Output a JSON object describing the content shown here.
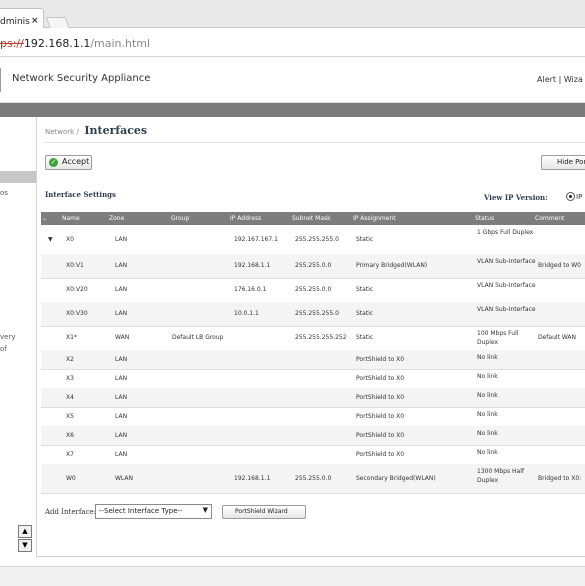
{
  "browser": {
    "tab_title": "dminis",
    "tab_close": "×",
    "url_scheme": "ps://",
    "url_host": "192.168.1.1",
    "url_path": "/main.html"
  },
  "header": {
    "product": "Network Security Appliance",
    "links": "Alert | Wiza"
  },
  "sidebar": {
    "fragments": [
      "os",
      "very",
      "of"
    ]
  },
  "page": {
    "breadcrumb": "Network /",
    "title": "Interfaces",
    "accept_label": "Accept",
    "hide_label": "Hide Por",
    "section_title": "Interface Settings",
    "view_ip_label": "View IP Version:",
    "ip_option": "IP"
  },
  "table": {
    "columns": [
      "Name",
      "Zone",
      "Group",
      "IP Address",
      "Subnet Mask",
      "IP Assignment",
      "Status",
      "Comment"
    ],
    "rows": [
      {
        "expander": "▼",
        "name": "X0",
        "zone": "LAN",
        "group": "",
        "ip": "192.167.167.1",
        "mask": "255.255.255.0",
        "assign": "Static",
        "status": "1 Gbps Full Duplex",
        "comment": ""
      },
      {
        "expander": "",
        "name": "X0:V1",
        "zone": "LAN",
        "group": "",
        "ip": "192.168.1.1",
        "mask": "255.255.0.0",
        "assign": "Primary Bridged(WLAN)",
        "status": "VLAN Sub-Interface",
        "comment": "Bridged to W0"
      },
      {
        "expander": "",
        "name": "X0:V20",
        "zone": "LAN",
        "group": "",
        "ip": "176.16.0.1",
        "mask": "255.255.0.0",
        "assign": "Static",
        "status": "VLAN Sub-Interface",
        "comment": ""
      },
      {
        "expander": "",
        "name": "X0:V30",
        "zone": "LAN",
        "group": "",
        "ip": "10.0.1.1",
        "mask": "255.255.255.0",
        "assign": "Static",
        "status": "VLAN Sub-Interface",
        "comment": ""
      },
      {
        "expander": "",
        "name": "X1*",
        "zone": "WAN",
        "group": "Default LB Group",
        "ip": "",
        "mask": "255.255.255.252",
        "assign": "Static",
        "status": "100 Mbps Full Duplex",
        "comment": "Default WAN"
      },
      {
        "expander": "",
        "name": "X2",
        "zone": "LAN",
        "group": "",
        "ip": "",
        "mask": "",
        "assign": "PortShield to X0",
        "status": "No link",
        "comment": ""
      },
      {
        "expander": "",
        "name": "X3",
        "zone": "LAN",
        "group": "",
        "ip": "",
        "mask": "",
        "assign": "PortShield to X0",
        "status": "No link",
        "comment": ""
      },
      {
        "expander": "",
        "name": "X4",
        "zone": "LAN",
        "group": "",
        "ip": "",
        "mask": "",
        "assign": "PortShield to X0",
        "status": "No link",
        "comment": ""
      },
      {
        "expander": "",
        "name": "X5",
        "zone": "LAN",
        "group": "",
        "ip": "",
        "mask": "",
        "assign": "PortShield to X0",
        "status": "No link",
        "comment": ""
      },
      {
        "expander": "",
        "name": "X6",
        "zone": "LAN",
        "group": "",
        "ip": "",
        "mask": "",
        "assign": "PortShield to X0",
        "status": "No link",
        "comment": ""
      },
      {
        "expander": "",
        "name": "X7",
        "zone": "LAN",
        "group": "",
        "ip": "",
        "mask": "",
        "assign": "PortShield to X0",
        "status": "No link",
        "comment": ""
      },
      {
        "expander": "",
        "name": "W0",
        "zone": "WLAN",
        "group": "",
        "ip": "192.168.1.1",
        "mask": "255.255.0.0",
        "assign": "Secondary Bridged(WLAN)",
        "status": "1300 Mbps Half Duplex",
        "comment": "Bridged to X0:"
      }
    ]
  },
  "footer": {
    "add_label": "Add Interface:",
    "select_value": "--Select Interface Type--",
    "select_arrow": "▼",
    "wizard_label": "PortShield Wizard"
  },
  "icons": {
    "accept": "check-circle-icon",
    "scroll_up": "arrow-up-icon",
    "scroll_down": "arrow-down-icon",
    "accept_color": "#3ba535"
  }
}
